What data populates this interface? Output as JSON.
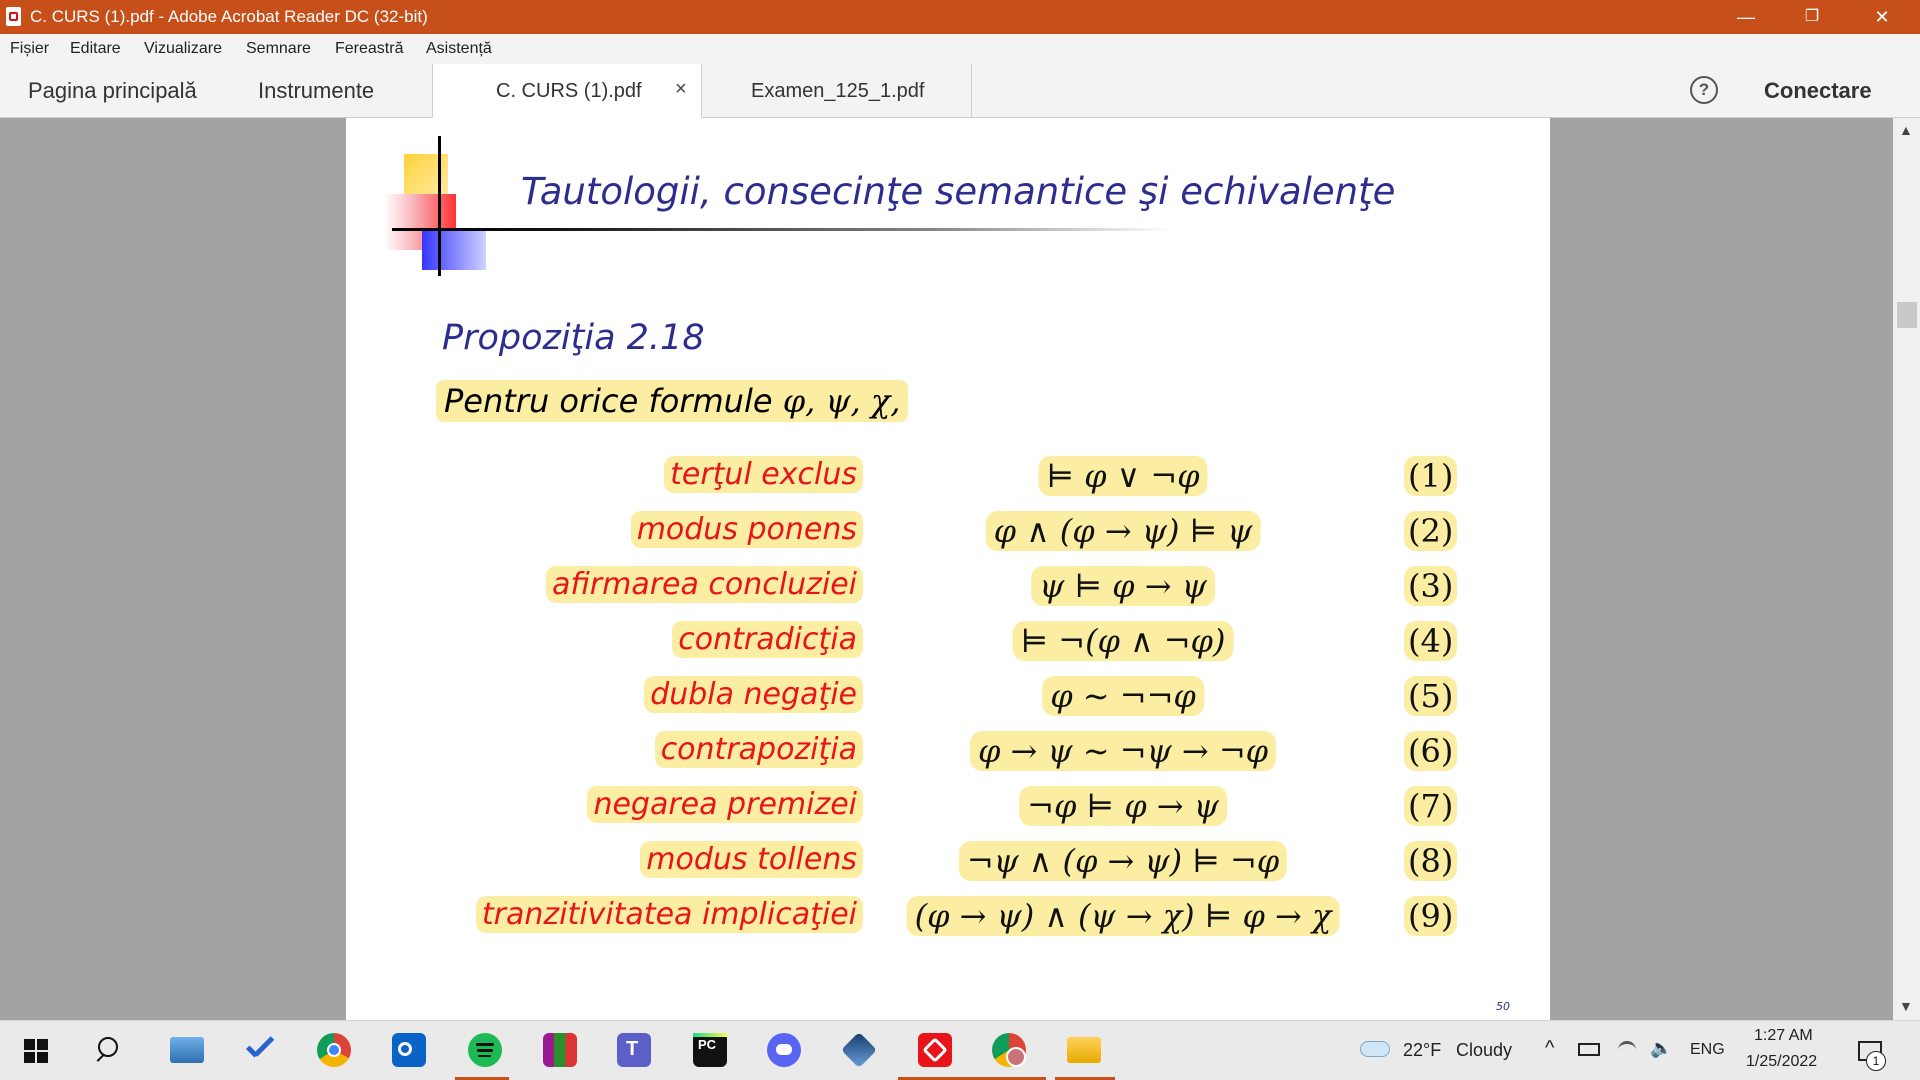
{
  "window": {
    "title": "C. CURS (1).pdf - Adobe Acrobat Reader DC (32-bit)",
    "minimize": "—",
    "restore": "❐",
    "close": "✕"
  },
  "menu": [
    "Fișier",
    "Editare",
    "Vizualizare",
    "Semnare",
    "Fereastră",
    "Asistență"
  ],
  "tabs": {
    "home": "Pagina principală",
    "tools": "Instrumente",
    "documents": [
      {
        "label": "C. CURS (1).pdf",
        "close": "×"
      },
      {
        "label": "Examen_125_1.pdf"
      }
    ],
    "help": "?",
    "connect": "Conectare"
  },
  "slide": {
    "title": "Tautologii, consecinţe semantice şi echivalenţe",
    "proposition_title": "Propoziţia 2.18",
    "proposition_text": "Pentru orice formule ",
    "proposition_math": "φ, ψ, χ,",
    "rows": [
      {
        "label": "terţul exclus",
        "formula": "⊨ φ ∨ ¬φ",
        "number": "(1)"
      },
      {
        "label": "modus ponens",
        "formula": "φ ∧ (φ → ψ) ⊨ ψ",
        "number": "(2)"
      },
      {
        "label": "afirmarea concluziei",
        "formula": "ψ ⊨ φ → ψ",
        "number": "(3)"
      },
      {
        "label": "contradicţia",
        "formula": "⊨ ¬(φ ∧ ¬φ)",
        "number": "(4)"
      },
      {
        "label": "dubla negaţie",
        "formula": "φ ∼ ¬¬φ",
        "number": "(5)"
      },
      {
        "label": "contrapoziţia",
        "formula": "φ → ψ ∼ ¬ψ → ¬φ",
        "number": "(6)"
      },
      {
        "label": "negarea premizei",
        "formula": "¬φ ⊨ φ → ψ",
        "number": "(7)"
      },
      {
        "label": "modus tollens",
        "formula": "¬ψ ∧ (φ → ψ) ⊨ ¬φ",
        "number": "(8)"
      },
      {
        "label": "tranzitivitatea implicaţiei",
        "formula": "(φ → ψ) ∧ (ψ → χ) ⊨ φ → χ",
        "number": "(9)"
      }
    ],
    "page_number": "50"
  },
  "taskbar": {
    "weather_temp": "22°F",
    "weather_desc": "Cloudy",
    "language": "ENG",
    "time": "1:27 AM",
    "date": "1/25/2022",
    "notifications": "1",
    "apps": [
      "windows-start",
      "search",
      "file-explorer-pc",
      "todo",
      "chrome",
      "outlook",
      "spotify",
      "winrar",
      "teams",
      "pycharm",
      "discord",
      "virtualbox",
      "acrobat",
      "chrome-profile",
      "file-explorer"
    ]
  },
  "colors": {
    "titlebar": "#c7501a",
    "highlight": "#fbeda2",
    "label_red": "#e8141a",
    "slide_blue": "#2d2d8f"
  }
}
